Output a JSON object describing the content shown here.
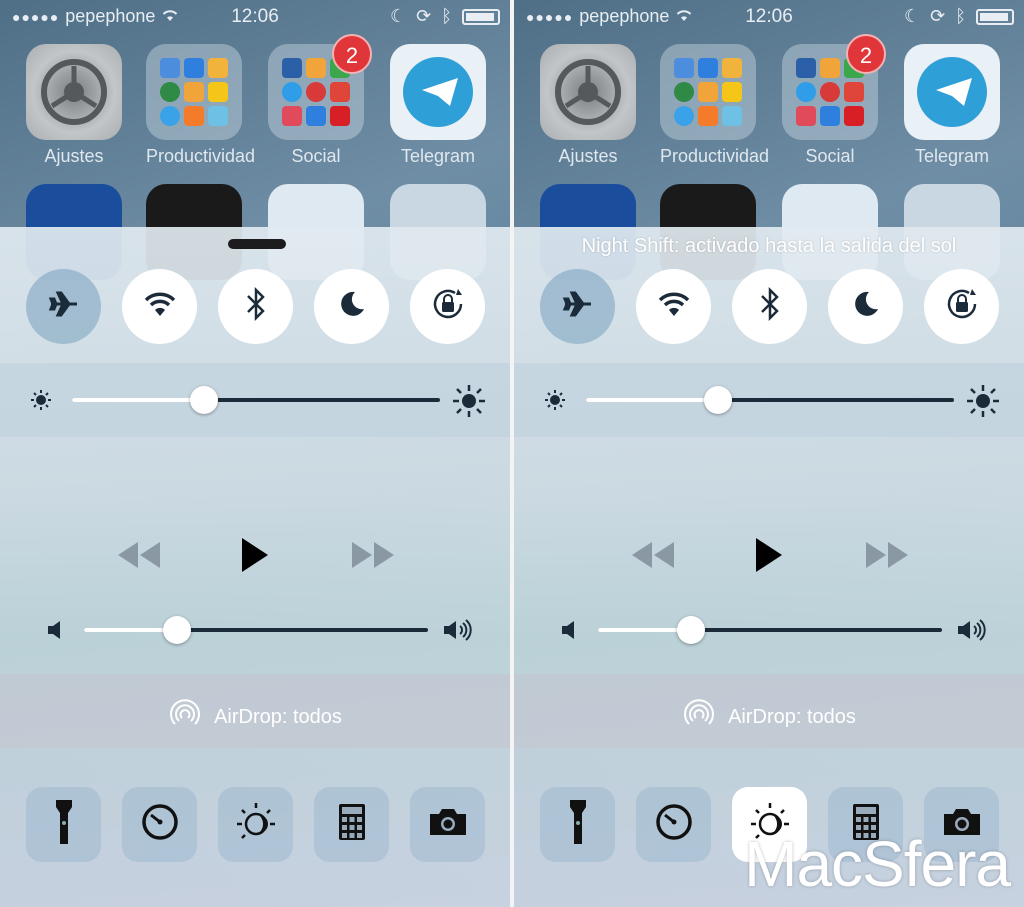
{
  "screens": [
    {
      "status": {
        "carrier": "pepephone",
        "signal_dots": "●●●●●",
        "time": "12:06"
      },
      "apps": [
        {
          "label": "Ajustes",
          "icon": "settings-gear-icon"
        },
        {
          "label": "Productividad",
          "icon": "folder-icon"
        },
        {
          "label": "Social",
          "icon": "folder-icon",
          "badge": "2"
        },
        {
          "label": "Telegram",
          "icon": "telegram-icon"
        }
      ],
      "control_center": {
        "header": "",
        "toggles": [
          {
            "name": "airplane-mode",
            "state": "off"
          },
          {
            "name": "wifi",
            "state": "on"
          },
          {
            "name": "bluetooth",
            "state": "on"
          },
          {
            "name": "do-not-disturb",
            "state": "on"
          },
          {
            "name": "rotation-lock",
            "state": "on"
          }
        ],
        "brightness": 0.36,
        "volume": 0.27,
        "airdrop_label": "AirDrop: todos",
        "tools": [
          {
            "name": "flashlight",
            "state": "off"
          },
          {
            "name": "timer",
            "state": "off"
          },
          {
            "name": "night-shift",
            "state": "off"
          },
          {
            "name": "calculator",
            "state": "off"
          },
          {
            "name": "camera",
            "state": "off"
          }
        ]
      }
    },
    {
      "status": {
        "carrier": "pepephone",
        "signal_dots": "●●●●●",
        "time": "12:06"
      },
      "apps": [
        {
          "label": "Ajustes",
          "icon": "settings-gear-icon"
        },
        {
          "label": "Productividad",
          "icon": "folder-icon"
        },
        {
          "label": "Social",
          "icon": "folder-icon",
          "badge": "2"
        },
        {
          "label": "Telegram",
          "icon": "telegram-icon"
        }
      ],
      "control_center": {
        "header": "Night Shift: activado hasta la salida del sol",
        "toggles": [
          {
            "name": "airplane-mode",
            "state": "off"
          },
          {
            "name": "wifi",
            "state": "on"
          },
          {
            "name": "bluetooth",
            "state": "on"
          },
          {
            "name": "do-not-disturb",
            "state": "on"
          },
          {
            "name": "rotation-lock",
            "state": "on"
          }
        ],
        "brightness": 0.36,
        "volume": 0.27,
        "airdrop_label": "AirDrop: todos",
        "tools": [
          {
            "name": "flashlight",
            "state": "off"
          },
          {
            "name": "timer",
            "state": "off"
          },
          {
            "name": "night-shift",
            "state": "on"
          },
          {
            "name": "calculator",
            "state": "off"
          },
          {
            "name": "camera",
            "state": "off"
          }
        ]
      }
    }
  ],
  "watermark": "MacSfera",
  "colors": {
    "accent_dark": "#1c2b3a",
    "badge_red": "#e0363a",
    "telegram_blue": "#2f9fd8"
  }
}
